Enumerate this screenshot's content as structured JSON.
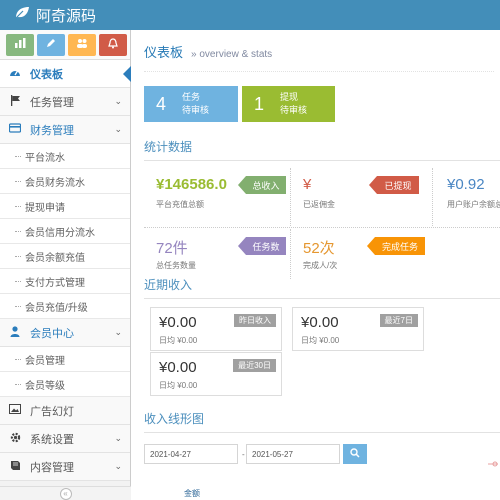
{
  "header": {
    "brand": "阿奇源码",
    "logo_icon": "leaf-icon"
  },
  "sidebar": {
    "shortcuts": [
      {
        "icon": "chart-icon",
        "color": "#87b87f"
      },
      {
        "icon": "pencil-icon",
        "color": "#6fb3e0"
      },
      {
        "icon": "users-icon",
        "color": "#ffb752"
      },
      {
        "icon": "bell-icon",
        "color": "#d15b47"
      }
    ],
    "items": [
      {
        "label": "仪表板",
        "icon": "dashboard-icon",
        "active": true
      },
      {
        "label": "任务管理",
        "icon": "flag-icon"
      },
      {
        "label": "财务管理",
        "icon": "credit-card-icon",
        "open": true,
        "children": [
          "平台流水",
          "会员财务流水",
          "提现申请",
          "会员信用分流水",
          "会员余额充值",
          "支付方式管理",
          "会员充值/升级"
        ]
      },
      {
        "label": "会员中心",
        "icon": "user-icon",
        "open": true,
        "children": [
          "会员管理",
          "会员等级"
        ]
      },
      {
        "label": "广告幻灯",
        "icon": "picture-icon"
      },
      {
        "label": "系统设置",
        "icon": "gear-icon"
      },
      {
        "label": "内容管理",
        "icon": "book-icon"
      }
    ]
  },
  "page": {
    "title": "仪表板",
    "subtitle": "overview & stats"
  },
  "infoboxes": [
    {
      "num": "4",
      "line1": "任务",
      "line2": "待审核",
      "color": "#6fb3e0"
    },
    {
      "num": "1",
      "line1": "提现",
      "line2": "待审核",
      "color": "#9abc32"
    }
  ],
  "stats": {
    "title": "统计数据",
    "boxes": [
      {
        "value": "¥146586.0",
        "caption": "平台充值总额",
        "badge": "总收入",
        "value_color": "#9abc32",
        "badge_color": "#82af6f"
      },
      {
        "value": "¥",
        "caption": "已返佣金",
        "badge": "已提现",
        "value_color": "#d15b47",
        "badge_color": "#d15b47"
      },
      {
        "value": "¥0.92",
        "caption": "用户账户余额总",
        "badge": "",
        "value_color": "#4a86c3",
        "badge_color": ""
      },
      {
        "value": "72件",
        "caption": "总任务数量",
        "badge": "任务数",
        "value_color": "#9585bf",
        "badge_color": "#9585bf"
      },
      {
        "value": "52次",
        "caption": "完成人/次",
        "badge": "完成任务",
        "value_color": "#e59730",
        "badge_color": "#f89406"
      }
    ]
  },
  "recent": {
    "title": "近期收入",
    "boxes": [
      {
        "value": "¥0.00",
        "sub": "日均 ¥0.00",
        "tag": "昨日收入"
      },
      {
        "value": "¥0.00",
        "sub": "日均 ¥0.00",
        "tag": "最近7日"
      },
      {
        "value": "¥0.00",
        "sub": "日均 ¥0.00",
        "tag": "最近30日"
      }
    ]
  },
  "chart_section": {
    "title": "收入线形图",
    "date_from": "2021-04-27",
    "date_sep": "-",
    "date_to": "2021-05-27",
    "search_icon": "search-icon",
    "legend": "金额"
  }
}
